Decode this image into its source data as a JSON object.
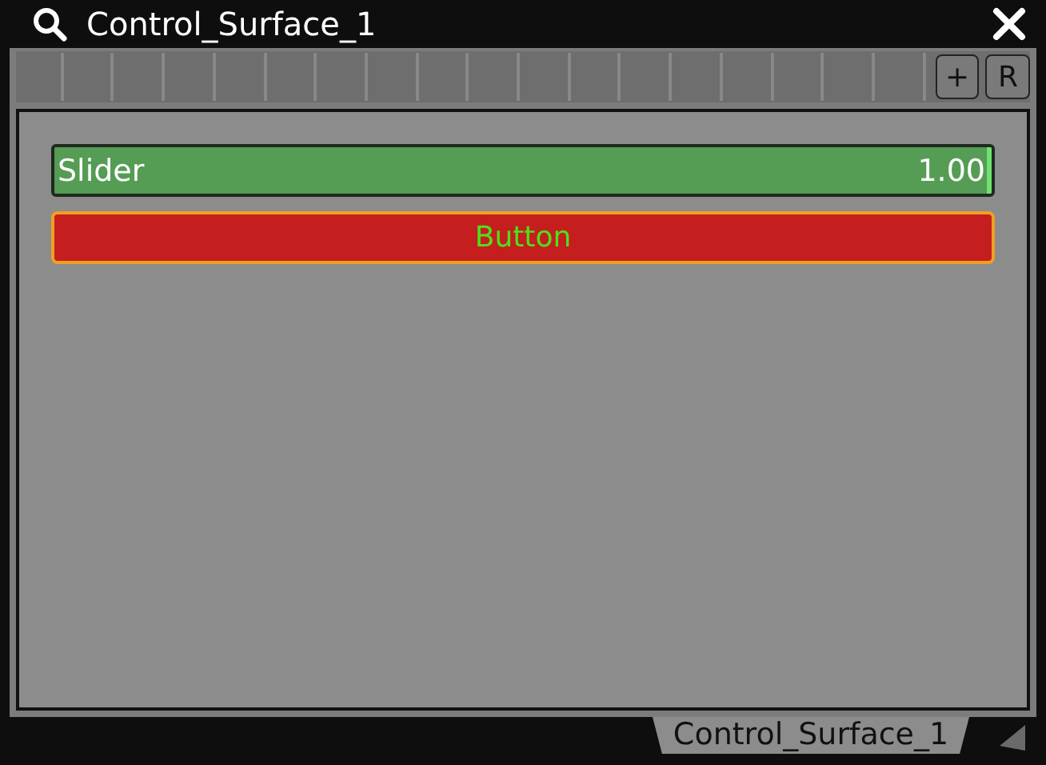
{
  "window": {
    "title": "Control_Surface_1"
  },
  "toolbar": {
    "buttons": [
      {
        "label": "+"
      },
      {
        "label": "R"
      }
    ]
  },
  "controls": [
    {
      "kind": "slider",
      "label": "Slider",
      "reading": "1.00",
      "level": 1.0
    },
    {
      "kind": "button",
      "label": "Button"
    }
  ],
  "footer_tab": {
    "label": "Control_Surface_1"
  }
}
